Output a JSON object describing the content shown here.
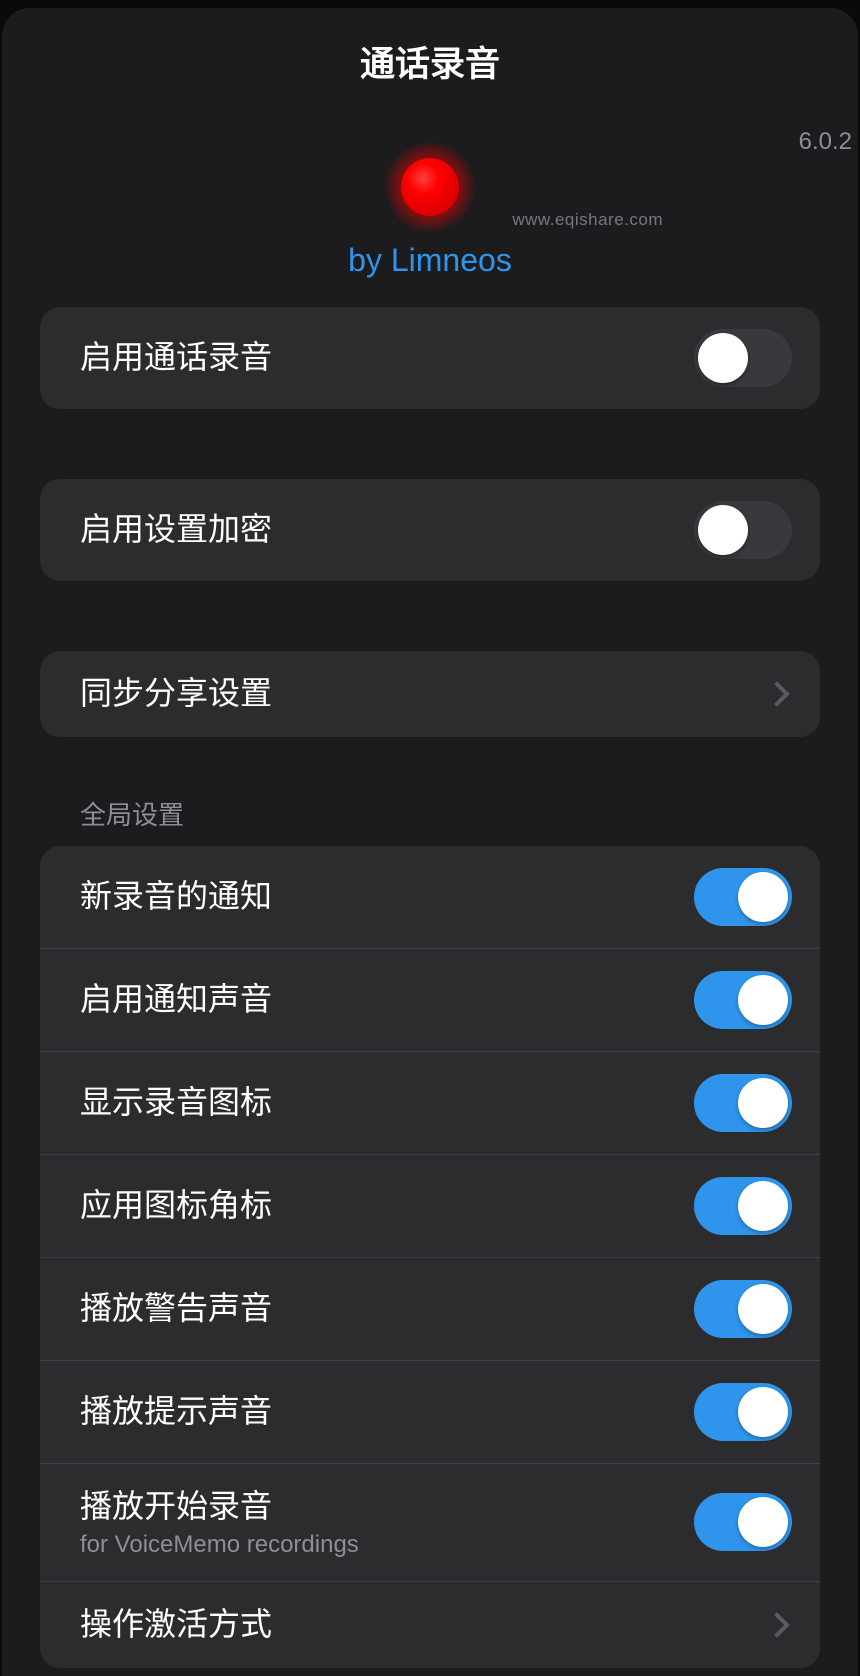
{
  "title": "通话录音",
  "version": "6.0.2",
  "watermark": "www.eqishare.com",
  "byline": "by Limneos",
  "sectionHeader": "全局设置",
  "rows": {
    "enableRecording": "启用通话录音",
    "enableEncryption": "启用设置加密",
    "syncShare": "同步分享设置",
    "newRecNotify": "新录音的通知",
    "enableSound": "启用通知声音",
    "showIcon": "显示录音图标",
    "appBadge": "应用图标角标",
    "playWarning": "播放警告声音",
    "playPrompt": "播放提示声音",
    "playStart": "播放开始录音",
    "playStartSub": "for VoiceMemo recordings",
    "activation": "操作激活方式"
  },
  "states": {
    "enableRecording": false,
    "enableEncryption": false,
    "newRecNotify": true,
    "enableSound": true,
    "showIcon": true,
    "appBadge": true,
    "playWarning": true,
    "playPrompt": true,
    "playStart": true
  }
}
